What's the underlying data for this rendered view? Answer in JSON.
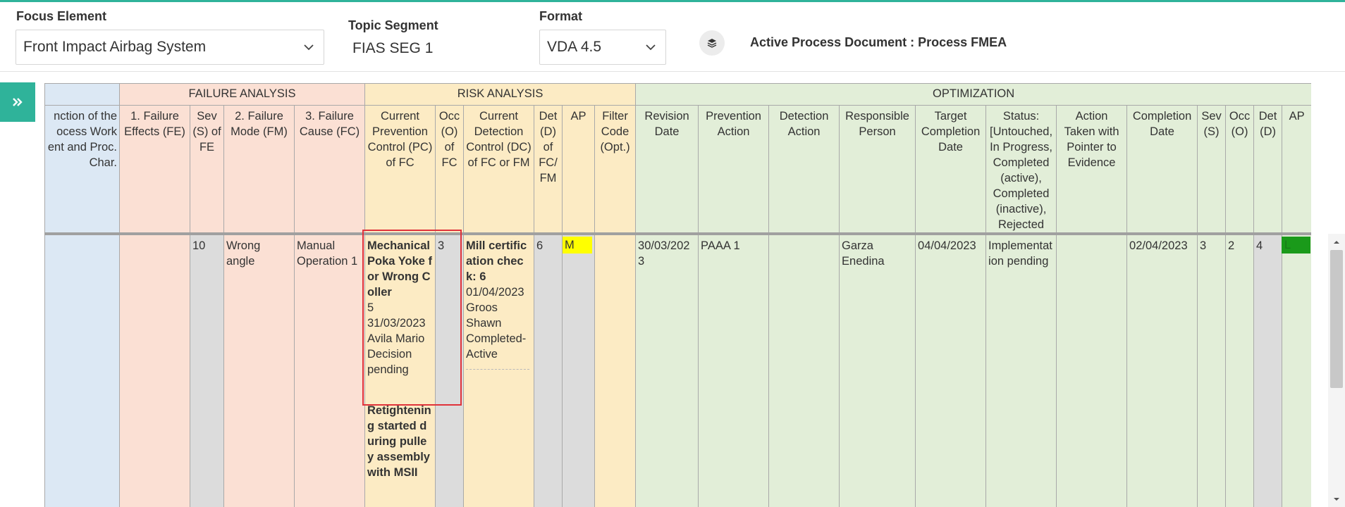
{
  "toolbar": {
    "focus_label": "Focus Element",
    "focus_value": "Front Impact Airbag System",
    "topic_label": "Topic Segment",
    "topic_value": "FIAS SEG 1",
    "format_label": "Format",
    "format_value": "VDA 4.5",
    "active_doc": "Active Process Document : Process FMEA"
  },
  "groups": {
    "failure": "FAILURE ANALYSIS",
    "risk": "RISK ANALYSIS",
    "optimization": "OPTIMIZATION"
  },
  "headers": {
    "function": "nction of the\nocess Work\nent and Proc.\nChar.",
    "fe": "1. Failure Effects (FE)",
    "sev": "Sev (S) of FE",
    "fm": "2. Failure Mode (FM)",
    "fc": "3. Failure Cause (FC)",
    "pc": "Current Prevention Control (PC) of FC",
    "occ": "Occ (O) of FC",
    "dc": "Current Detection Control (DC) of FC or FM",
    "det": "Det (D) of FC/ FM",
    "ap": "AP",
    "filter": "Filter Code (Opt.)",
    "revision": "Revision Date",
    "prev_action": "Prevention Action",
    "det_action": "Detection Action",
    "responsible": "Responsible Person",
    "target": "Target Completion Date",
    "status": "Status: [Untouched, In Progress, Completed (active), Completed (inactive), Rejected",
    "action_taken": "Action Taken with Pointer to Evidence",
    "completion": "Completion Date",
    "sev2": "Sev (S)",
    "occ2": "Occ (O)",
    "det2": "Det (D)",
    "ap2": "AP"
  },
  "row": {
    "sev": "10",
    "fm": "Wrong angle",
    "fc": "Manual Operation 1",
    "pc1_title": "Mechanical Poka Yoke for Wrong Coller",
    "pc1_occ": "5",
    "pc1_date": "31/03/2023",
    "pc1_person": "Avila Mario",
    "pc1_status": "Decision pending",
    "pc2_title": "Retightening started during pulley assembly with MSII",
    "occ": "3",
    "dc_title": "Mill certification check: 6",
    "dc_date": "01/04/2023",
    "dc_person": "Groos Shawn",
    "dc_status": "Completed-Active",
    "det": "6",
    "ap": "M",
    "revision": "30/03/2023",
    "prev_action": "PAAA 1",
    "responsible": "Garza Enedina",
    "target": "04/04/2023",
    "status": "Implementation pending",
    "completion": "02/04/2023",
    "sev2": "3",
    "occ2": "2",
    "det2": "4",
    "ap2": "L"
  },
  "colors": {
    "accent": "#2fb39a",
    "ap_medium": "#ffff00",
    "ap_low": "#1a9a1a",
    "highlight": "#e0323a"
  }
}
